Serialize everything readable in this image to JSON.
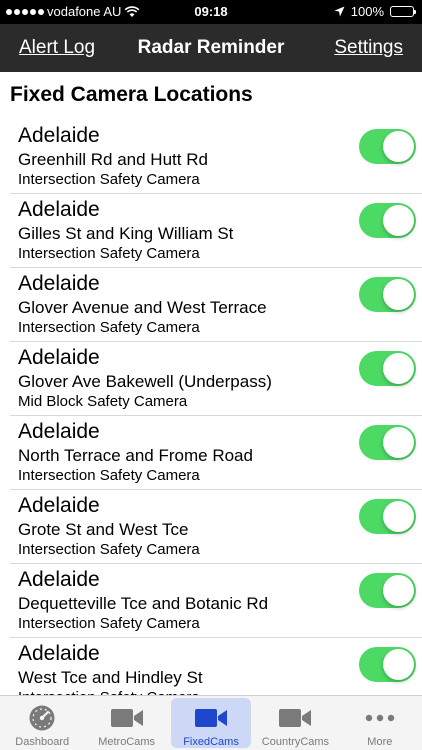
{
  "status": {
    "carrier": "vodafone AU",
    "time": "09:18",
    "battery": "100%"
  },
  "nav": {
    "left": "Alert Log",
    "title": "Radar Reminder",
    "right": "Settings"
  },
  "section_title": "Fixed Camera Locations",
  "cameras": [
    {
      "city": "Adelaide",
      "street": "Greenhill Rd and Hutt Rd",
      "kind": "Intersection Safety Camera",
      "enabled": true
    },
    {
      "city": "Adelaide",
      "street": "Gilles St and King William St",
      "kind": "Intersection Safety Camera",
      "enabled": true
    },
    {
      "city": "Adelaide",
      "street": "Glover Avenue and West Terrace",
      "kind": "Intersection Safety Camera",
      "enabled": true
    },
    {
      "city": "Adelaide",
      "street": "Glover Ave Bakewell (Underpass)",
      "kind": "Mid Block Safety Camera",
      "enabled": true
    },
    {
      "city": "Adelaide",
      "street": "North Terrace and Frome Road",
      "kind": "Intersection Safety Camera",
      "enabled": true
    },
    {
      "city": "Adelaide",
      "street": "Grote St and West Tce",
      "kind": "Intersection Safety Camera",
      "enabled": true
    },
    {
      "city": "Adelaide",
      "street": "Dequetteville Tce and Botanic Rd",
      "kind": "Intersection Safety Camera",
      "enabled": true
    },
    {
      "city": "Adelaide",
      "street": "West Tce and Hindley St",
      "kind": "Intersection Safety Camera",
      "enabled": true
    }
  ],
  "tabs": [
    {
      "label": "Dashboard",
      "icon": "dashboard-gauge-icon",
      "active": false
    },
    {
      "label": "MetroCams",
      "icon": "video-camera-icon",
      "active": false
    },
    {
      "label": "FixedCams",
      "icon": "video-camera-icon",
      "active": true
    },
    {
      "label": "CountryCams",
      "icon": "video-camera-icon",
      "active": false
    },
    {
      "label": "More",
      "icon": "more-dots-icon",
      "active": false
    }
  ],
  "colors": {
    "toggle_on": "#4cd964",
    "tab_active": "#1e47cc",
    "tab_inactive": "#7a7a7a",
    "nav_bg": "#2b2b2b"
  }
}
